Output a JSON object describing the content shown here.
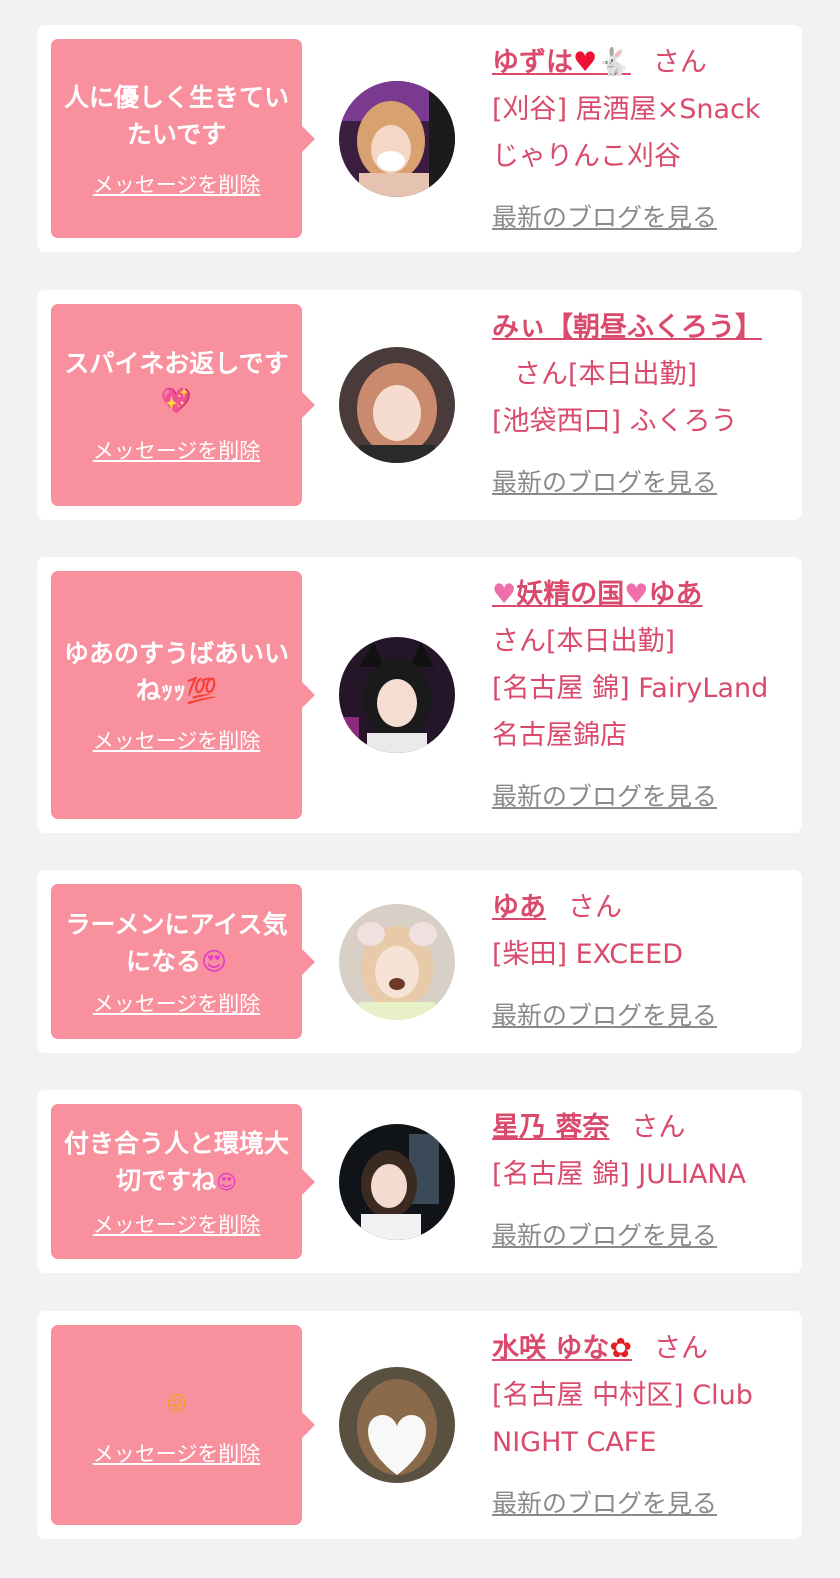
{
  "delete_label": "メッセージを削除",
  "blog_label": "最新のブログを見る",
  "honorific": "さん",
  "status_today": "[本日出勤]",
  "cards": [
    {
      "message": "人に優しく生きていたいです",
      "name": "ゆずは",
      "name_suffix_icons": [
        "red-heart-icon",
        "rabbit-icon"
      ],
      "status": "",
      "shop": "[刈谷] 居酒屋×Snack じゃりんこ刈谷"
    },
    {
      "message": "スパイネお返しです",
      "message_icon": "sparkling-heart-icon",
      "name": "みぃ【朝昼ふくろう】",
      "status": "[本日出勤]",
      "shop": "[池袋西口] ふくろう"
    },
    {
      "message": "ゆあのすうばあいいねｯｯ",
      "message_icon": "hundred-points-icon",
      "name": "妖精の国",
      "name_full": "ゆあ",
      "name_icons": [
        "pink-heart-icon",
        "pink-heart-icon"
      ],
      "status": "[本日出勤]",
      "shop": "[名古屋 錦] FairyLand 名古屋錦店"
    },
    {
      "message": "ラーメンにアイス気になる",
      "message_icon": "heart-eyes-icon",
      "name": "ゆあ",
      "status": "",
      "shop": "[柴田] EXCEED"
    },
    {
      "message": "付き合う人と環境大切ですね",
      "message_icon": "heart-eyes-icon",
      "name": "星乃 蓉奈",
      "status": "",
      "shop": "[名古屋 錦] JULIANA"
    },
    {
      "message": "",
      "message_icon": "winking-face-icon",
      "name": "水咲 ゆな",
      "name_suffix_icons": [
        "flower-icon"
      ],
      "status": "",
      "shop": "[名古屋 中村区] Club NIGHT CAFE"
    }
  ],
  "colors": {
    "background": "#f2f2f2",
    "bubble": "#f8909e",
    "accent": "#d94a6c",
    "blog_link": "#8a8a8a"
  }
}
